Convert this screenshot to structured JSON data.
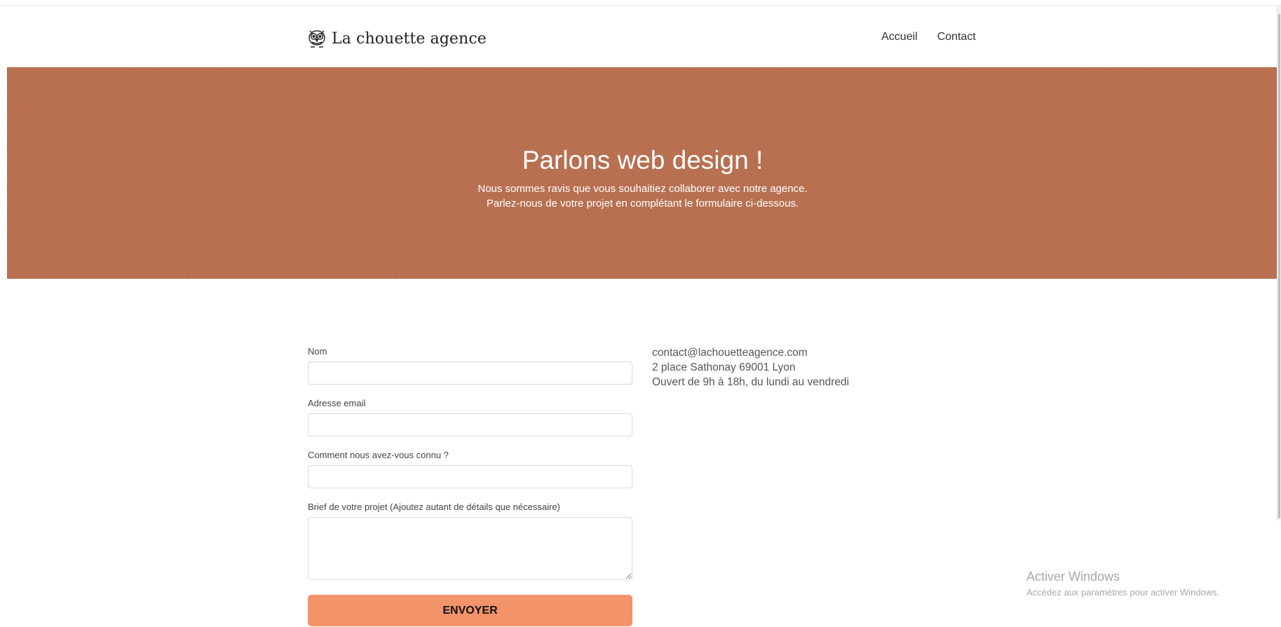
{
  "header": {
    "brand_name": "La chouette agence",
    "logo_icon": "owl-icon",
    "nav": [
      {
        "label": "Accueil"
      },
      {
        "label": "Contact"
      }
    ]
  },
  "hero": {
    "title": "Parlons web design !",
    "line1": "Nous sommes ravis que vous souhaitiez collaborer avec notre agence.",
    "line2": "Parlez-nous de votre projet en complétant le formulaire ci-dessous.",
    "background_color": "#b96f4e"
  },
  "form": {
    "fields": [
      {
        "label": "Nom",
        "value": ""
      },
      {
        "label": "Adresse email",
        "value": ""
      },
      {
        "label": "Comment nous avez-vous connu ?",
        "value": ""
      },
      {
        "label": "Brief de votre projet (Ajoutez autant de détails que nécessaire)",
        "value": ""
      }
    ],
    "submit_label": "ENVOYER",
    "submit_color": "#f2936a"
  },
  "contact": {
    "email": "contact@lachouetteagence.com",
    "address": "2 place Sathonay 69001 Lyon",
    "hours": "Ouvert de 9h à 18h, du lundi au vendredi"
  },
  "watermark": {
    "title": "Activer Windows",
    "subtitle": "Accédez aux paramètres pour activer Windows."
  }
}
